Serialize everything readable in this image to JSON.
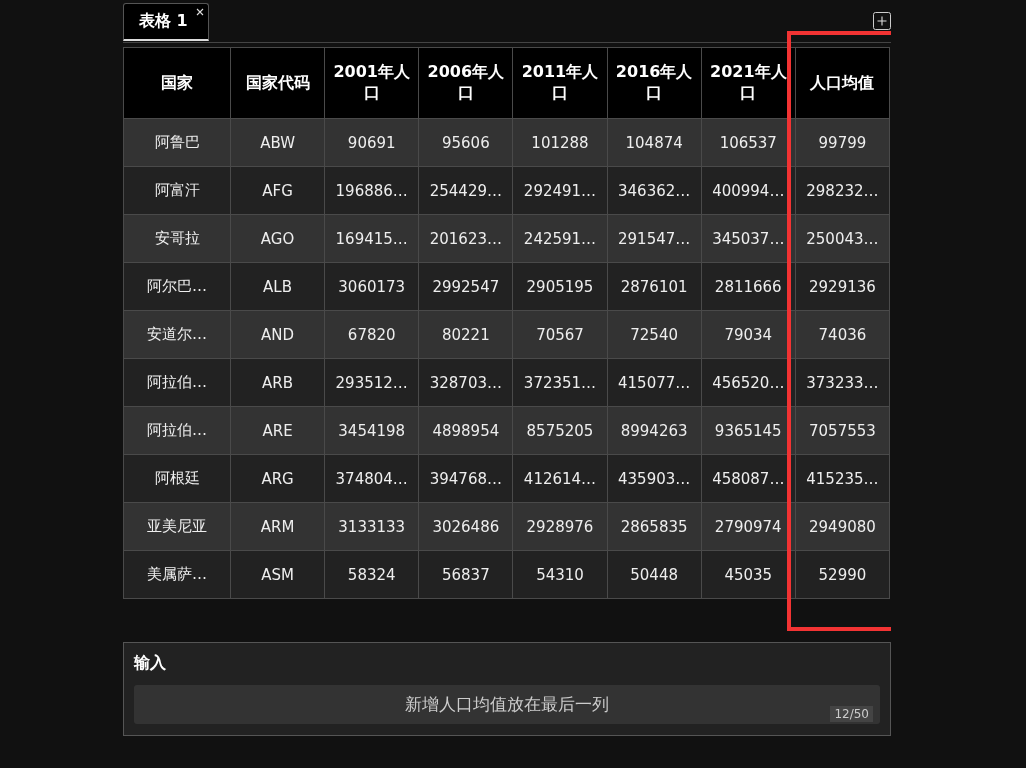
{
  "tabs": [
    {
      "label": "表格 1",
      "selected": true,
      "closable": true
    }
  ],
  "table": {
    "columns": [
      "国家",
      "国家代码",
      "2001年人口",
      "2006年人口",
      "2011年人口",
      "2016年人口",
      "2021年人口",
      "人口均值"
    ],
    "rows": [
      [
        "阿鲁巴",
        "ABW",
        "90691",
        "95606",
        "101288",
        "104874",
        "106537",
        "99799"
      ],
      [
        "阿富汗",
        "AFG",
        "196886…",
        "254429…",
        "292491…",
        "346362…",
        "400994…",
        "298232…"
      ],
      [
        "安哥拉",
        "AGO",
        "169415…",
        "201623…",
        "242591…",
        "291547…",
        "345037…",
        "250043…"
      ],
      [
        "阿尔巴…",
        "ALB",
        "3060173",
        "2992547",
        "2905195",
        "2876101",
        "2811666",
        "2929136"
      ],
      [
        "安道尔…",
        "AND",
        "67820",
        "80221",
        "70567",
        "72540",
        "79034",
        "74036"
      ],
      [
        "阿拉伯…",
        "ARB",
        "293512…",
        "328703…",
        "372351…",
        "415077…",
        "456520…",
        "373233…"
      ],
      [
        "阿拉伯…",
        "ARE",
        "3454198",
        "4898954",
        "8575205",
        "8994263",
        "9365145",
        "7057553"
      ],
      [
        "阿根廷",
        "ARG",
        "374804…",
        "394768…",
        "412614…",
        "435903…",
        "458087…",
        "415235…"
      ],
      [
        "亚美尼亚",
        "ARM",
        "3133133",
        "3026486",
        "2928976",
        "2865835",
        "2790974",
        "2949080"
      ],
      [
        "美属萨…",
        "ASM",
        "58324",
        "56837",
        "54310",
        "50448",
        "45035",
        "52990"
      ]
    ]
  },
  "input": {
    "title": "输入",
    "value": "新增人口均值放在最后一列",
    "counter": "12/50"
  }
}
